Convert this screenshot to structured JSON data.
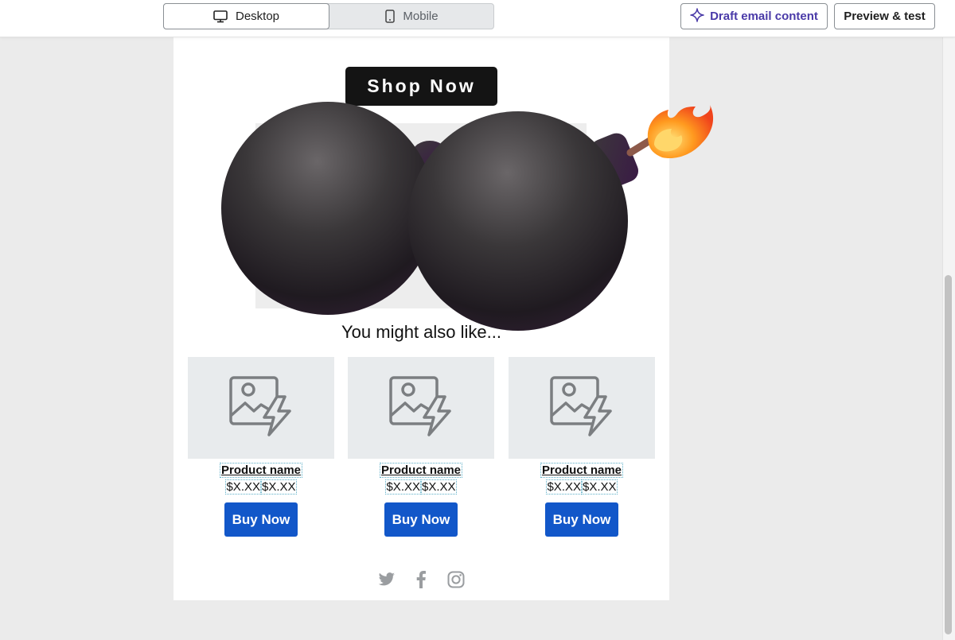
{
  "toolbar": {
    "desktop_label": "Desktop",
    "mobile_label": "Mobile",
    "draft_label": "Draft email content",
    "preview_label": "Preview & test"
  },
  "email": {
    "shop_now_label": "Shop Now",
    "recommendations_title": "You might also like...",
    "products": [
      {
        "name": "Product name",
        "price_1": "$X.XX",
        "price_2": "$X.XX",
        "button": "Buy Now"
      },
      {
        "name": "Product name",
        "price_1": "$X.XX",
        "price_2": "$X.XX",
        "button": "Buy Now"
      },
      {
        "name": "Product name",
        "price_1": "$X.XX",
        "price_2": "$X.XX",
        "button": "Buy Now"
      }
    ],
    "social_icons": [
      "twitter-icon",
      "facebook-icon",
      "instagram-icon"
    ]
  },
  "colors": {
    "accent_purple": "#4a3aa8",
    "buy_button_blue": "#1257c9",
    "shop_now_black": "#141414",
    "page_background": "#ebebeb"
  }
}
